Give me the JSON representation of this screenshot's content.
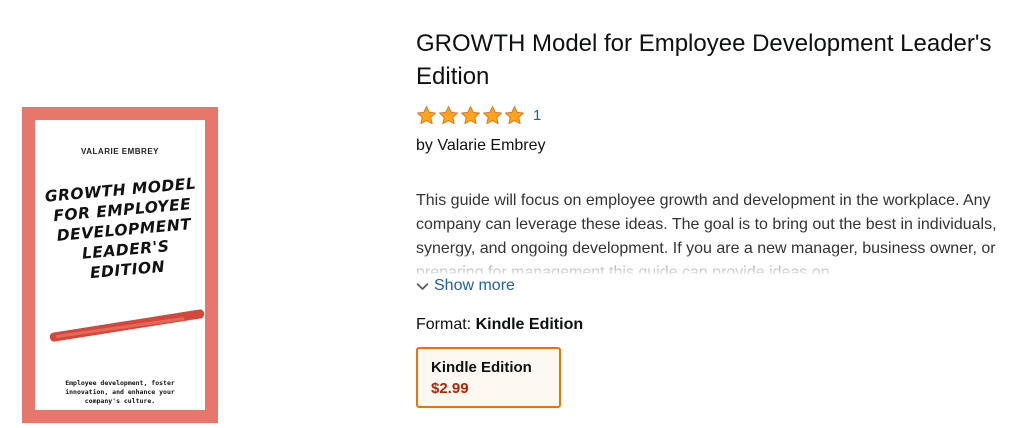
{
  "cover": {
    "author": "VALARIE EMBREY",
    "title_lines": [
      "GROWTH MODEL",
      "FOR EMPLOYEE",
      "DEVELOPMENT",
      "LEADER'S",
      "EDITION"
    ],
    "tagline": "Employee development, foster innovation, and enhance your company's culture.",
    "colors": {
      "border": "#e8776b",
      "stroke": "#d6463a"
    }
  },
  "product": {
    "title": "GROWTH Model for Employee Development Leader's Edition",
    "rating": {
      "stars": 5,
      "max": 5,
      "count": "1",
      "star_color": "#f3a847"
    },
    "byline": "by Valarie Embrey",
    "description": "This guide will focus on employee growth and development in the workplace. Any company can leverage these ideas. The goal is to bring out the best in individuals, synergy, and ongoing development. If you are a new manager, business owner, or preparing for management this guide can provide ideas on",
    "show_more": "Show more",
    "format_label": "Format:",
    "format_value": "Kindle Edition",
    "format_option": {
      "name": "Kindle Edition",
      "price": "$2.99"
    }
  },
  "colors": {
    "link": "#2162a1",
    "price": "#b12704",
    "selected_border": "#e77600"
  }
}
